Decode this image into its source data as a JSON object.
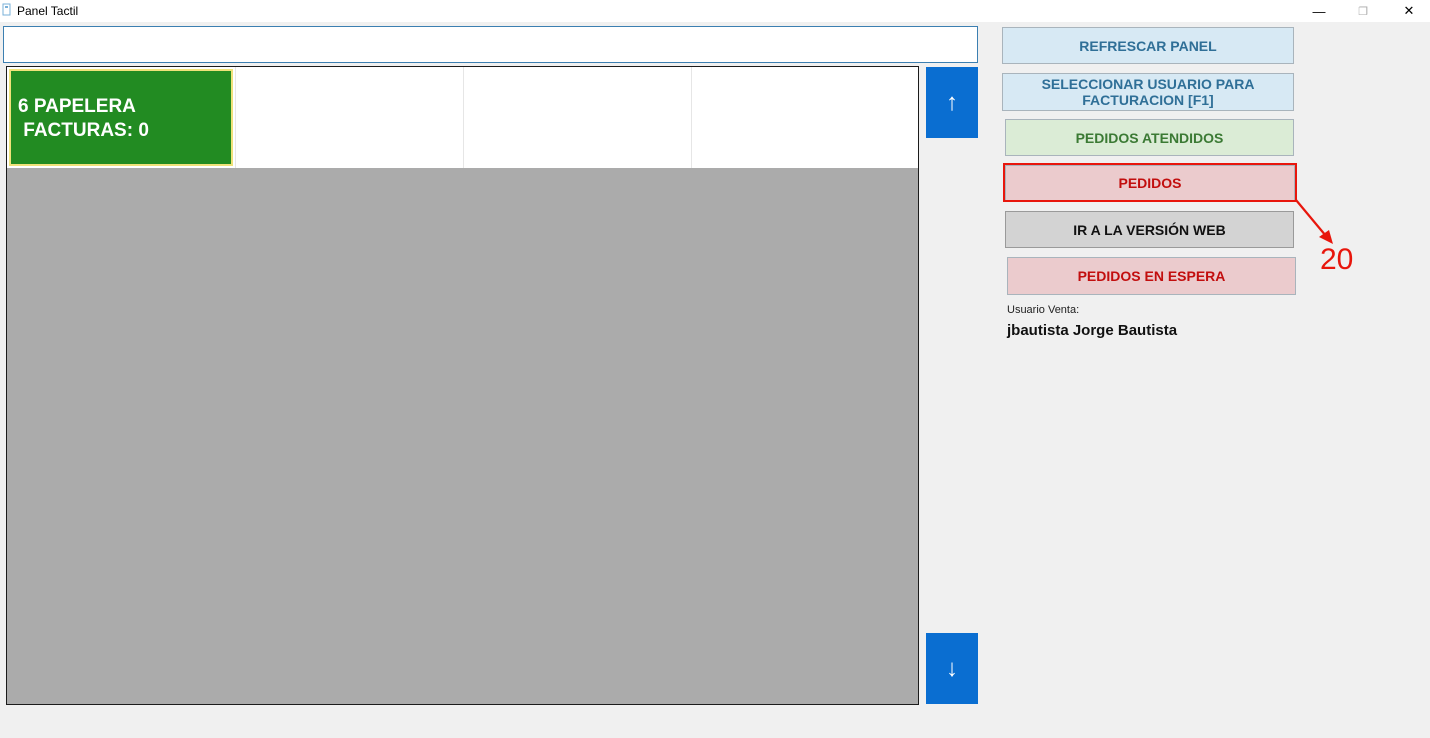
{
  "window": {
    "title": "Panel Tactil",
    "minimize_glyph": "—",
    "maximize_glyph": "❐",
    "close_glyph": "✕"
  },
  "search": {
    "value": "",
    "placeholder": ""
  },
  "tiles": [
    {
      "line1": "6 PAPELERA",
      "line2": " FACTURAS: 0",
      "color": "#228b22",
      "border_color": "#f0e27a"
    }
  ],
  "scroll": {
    "up": "↑",
    "down": "↓"
  },
  "buttons": {
    "refrescar": "REFRESCAR PANEL",
    "seleccionar": "SELECCIONAR USUARIO PARA FACTURACION [F1]",
    "atendidos": "PEDIDOS ATENDIDOS",
    "pedidos": "PEDIDOS",
    "web": "IR A LA VERSIÓN WEB",
    "espera": "PEDIDOS EN ESPERA"
  },
  "annotation": {
    "number": "20",
    "color": "#e8160c"
  },
  "usuario": {
    "label": "Usuario Venta:",
    "value": "jbautista Jorge Bautista"
  },
  "colors": {
    "scroll_button": "#0a6ed1",
    "panel_background": "#ababab"
  }
}
